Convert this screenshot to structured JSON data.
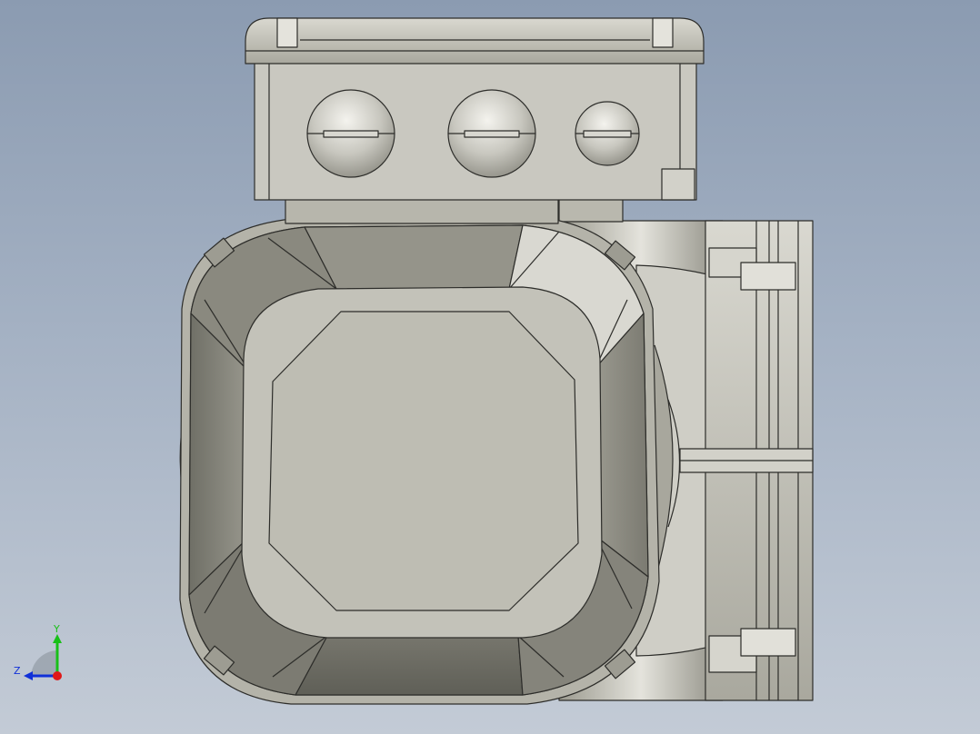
{
  "viewport": {
    "background_top": "#8b9bb1",
    "background_bottom": "#c3cbd6"
  },
  "model": {
    "body_color": "#c0bfb5",
    "edge_color": "#2d2d2a",
    "terminal_box": {
      "cable_glands": [
        "gland-large",
        "gland-large",
        "gland-small"
      ]
    }
  },
  "triad": {
    "y_label": "Y",
    "z_label": "Z",
    "y_color": "#18c018",
    "z_color": "#1030d8",
    "x_color": "#e01818"
  }
}
